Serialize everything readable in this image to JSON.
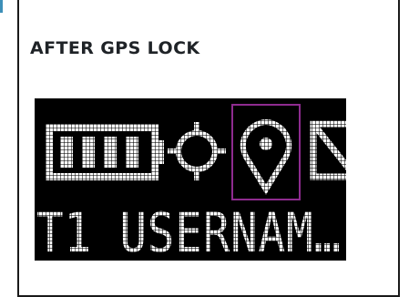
{
  "heading": "AFTER GPS LOCK",
  "display": {
    "username": "T1_USERNAM…",
    "icons": [
      "battery-icon",
      "gps-crosshair-icon",
      "location-pin-icon",
      "envelope-icon"
    ],
    "highlighted_icon": "location-pin-icon",
    "colors": {
      "background": "#000000",
      "foreground": "#ffffff",
      "highlight": "#8e2b8f",
      "accent": "#3d8fb8"
    }
  }
}
